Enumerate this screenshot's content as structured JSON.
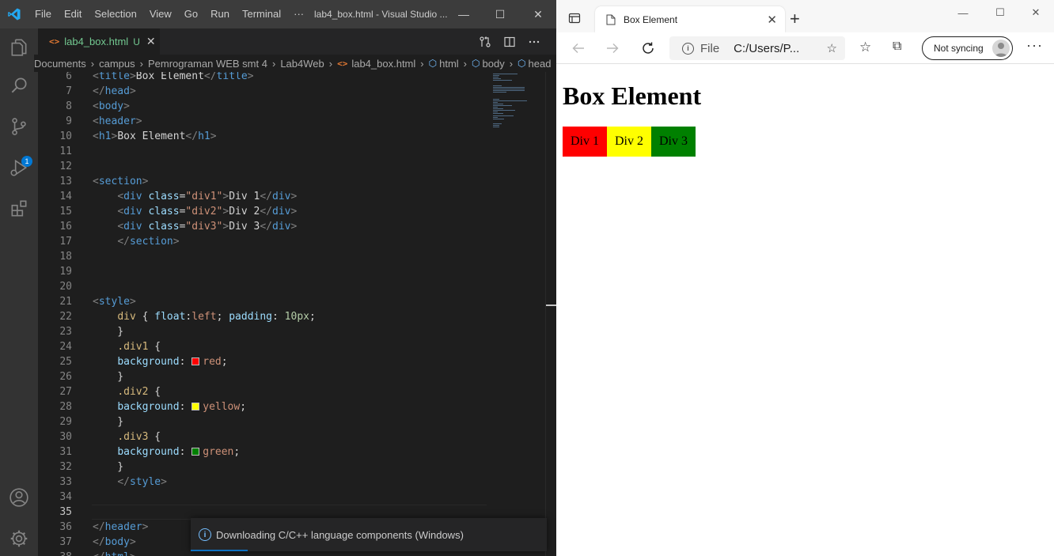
{
  "vscode": {
    "menu": [
      "File",
      "Edit",
      "Selection",
      "View",
      "Go",
      "Run",
      "Terminal",
      "···"
    ],
    "window_title": "lab4_box.html - Visual Studio ...",
    "window_controls": {
      "minimize": "—",
      "maximize": "☐",
      "close": "✕"
    },
    "tab": {
      "icon": "<>",
      "label": "lab4_box.html",
      "status": "U",
      "close": "✕"
    },
    "breadcrumb": [
      "Documents",
      "campus",
      "Pemrograman WEB smt 4",
      "Lab4Web",
      "lab4_box.html",
      "html",
      "body",
      "head"
    ],
    "scm_badge": "1",
    "editor": {
      "current_line": 35,
      "lines": [
        {
          "n": 6,
          "t": "<title>Box Element</title>"
        },
        {
          "n": 7,
          "t": "</head>"
        },
        {
          "n": 8,
          "t": "<body>"
        },
        {
          "n": 9,
          "t": "<header>"
        },
        {
          "n": 10,
          "t": "<h1>Box Element</h1>"
        },
        {
          "n": 11,
          "t": ""
        },
        {
          "n": 12,
          "t": ""
        },
        {
          "n": 13,
          "t": "<section>"
        },
        {
          "n": 14,
          "t": "    <div class=\"div1\">Div 1</div>"
        },
        {
          "n": 15,
          "t": "    <div class=\"div2\">Div 2</div>"
        },
        {
          "n": 16,
          "t": "    <div class=\"div3\">Div 3</div>"
        },
        {
          "n": 17,
          "t": "    </section>"
        },
        {
          "n": 18,
          "t": ""
        },
        {
          "n": 19,
          "t": ""
        },
        {
          "n": 20,
          "t": ""
        },
        {
          "n": 21,
          "t": "<style>"
        },
        {
          "n": 22,
          "t": "    div { float:left; padding: 10px;"
        },
        {
          "n": 23,
          "t": "    }"
        },
        {
          "n": 24,
          "t": "    .div1 {"
        },
        {
          "n": 25,
          "t": "    background: red;"
        },
        {
          "n": 26,
          "t": "    }"
        },
        {
          "n": 27,
          "t": "    .div2 {"
        },
        {
          "n": 28,
          "t": "    background: yellow;"
        },
        {
          "n": 29,
          "t": "    }"
        },
        {
          "n": 30,
          "t": "    .div3 {"
        },
        {
          "n": 31,
          "t": "    background: green;"
        },
        {
          "n": 32,
          "t": "    }"
        },
        {
          "n": 33,
          "t": "    </style>"
        },
        {
          "n": 34,
          "t": ""
        },
        {
          "n": 35,
          "t": ""
        },
        {
          "n": 36,
          "t": "</header>"
        },
        {
          "n": 37,
          "t": "</body>"
        },
        {
          "n": 38,
          "t": "</html>"
        }
      ]
    },
    "notification": {
      "icon": "info-icon",
      "text": "Downloading C/C++ language components (Windows)"
    },
    "colors": {
      "titlebar": "#3c3c3c",
      "activitybar": "#333333",
      "editor_bg": "#1e1e1e",
      "accent": "#0078d4"
    }
  },
  "browser": {
    "tab_title": "Box Element",
    "tab_close": "✕",
    "new_tab": "+",
    "window_controls": {
      "minimize": "—",
      "maximize": "☐",
      "close": "✕"
    },
    "address": {
      "scheme_label": "File",
      "url": "C:/Users/P..."
    },
    "sync_label": "Not syncing",
    "page": {
      "heading": "Box Element",
      "boxes": [
        {
          "label": "Div 1",
          "color": "#ff0000"
        },
        {
          "label": "Div 2",
          "color": "#ffff00"
        },
        {
          "label": "Div 3",
          "color": "#008000"
        }
      ]
    }
  }
}
